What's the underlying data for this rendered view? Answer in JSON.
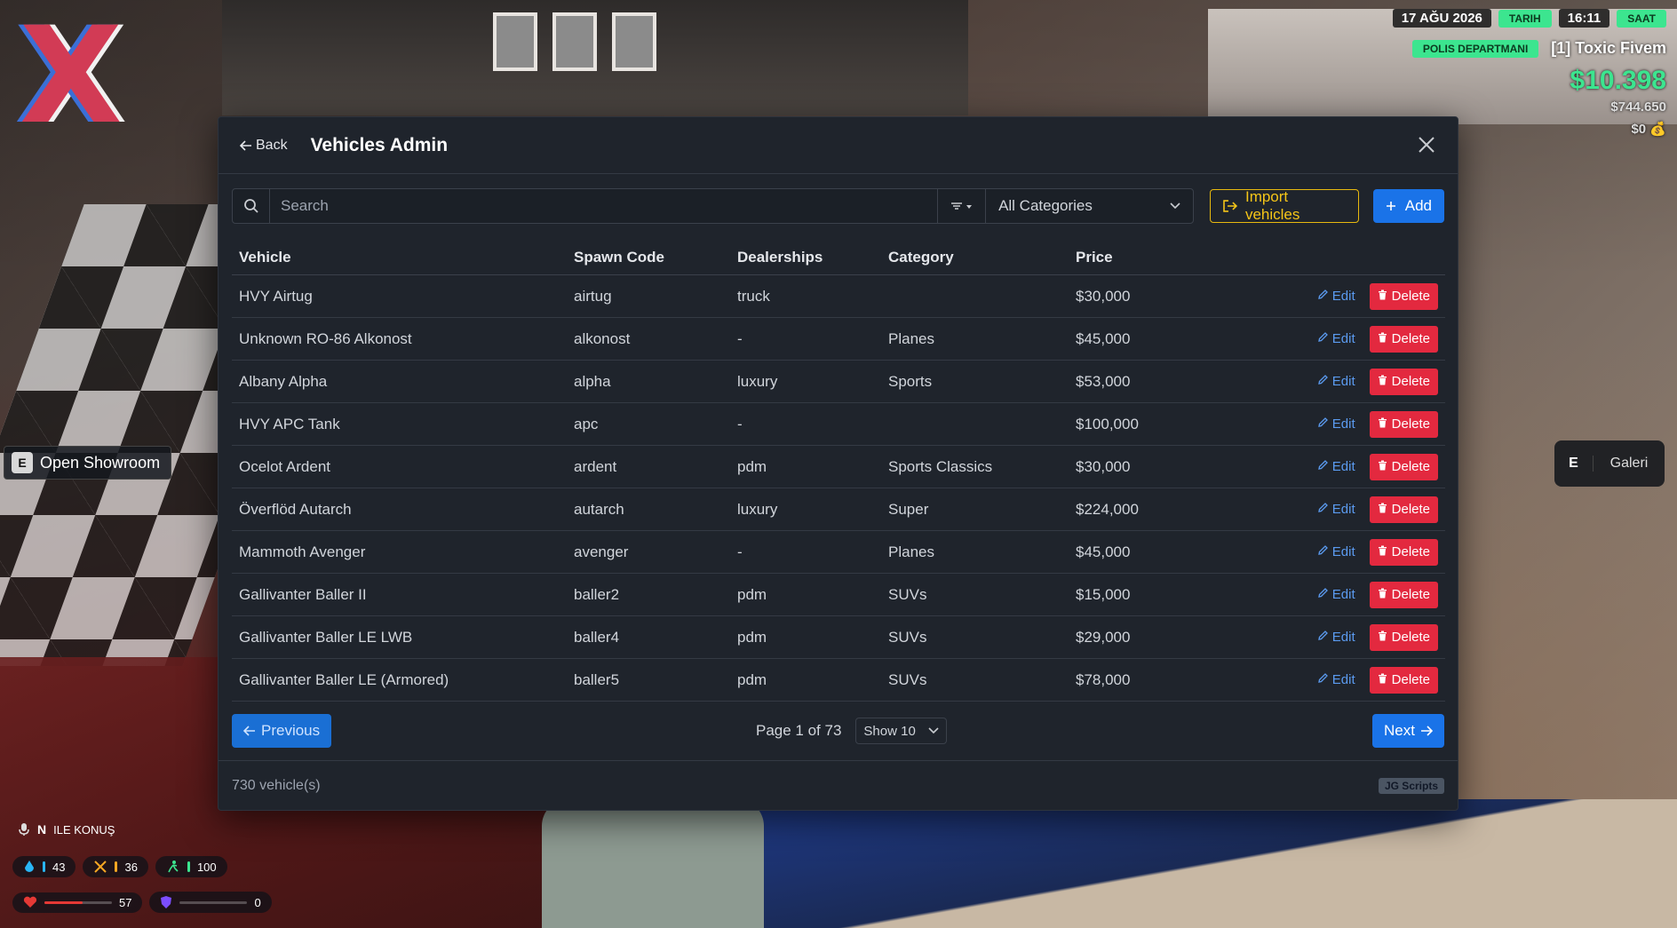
{
  "hud": {
    "date": "17 AĞU 2026",
    "date_label": "TARIH",
    "time": "16:11",
    "time_label": "SAAT",
    "job": "POLIS DEPARTMANI",
    "player": "[1] Toxic Fivem",
    "cash": "$10.398",
    "bank": "$744.650",
    "black_money": "$0",
    "voice_key": "N",
    "voice_label": "ILE KONUŞ",
    "stats": {
      "water": "43",
      "food": "36",
      "stamina": "100",
      "health": "57",
      "health_level": 0.57,
      "armor": "0"
    },
    "showroom_key": "E",
    "showroom_label": "Open Showroom",
    "galeri_key": "E",
    "galeri_label": "Galeri"
  },
  "modal": {
    "back_label": "Back",
    "title": "Vehicles Admin",
    "search_placeholder": "Search",
    "category_value": "All Categories",
    "import_label": "Import vehicles",
    "add_label": "Add",
    "columns": {
      "vehicle": "Vehicle",
      "spawn": "Spawn Code",
      "dealerships": "Dealerships",
      "category": "Category",
      "price": "Price"
    },
    "edit_label": "Edit",
    "delete_label": "Delete",
    "rows": [
      {
        "vehicle": "HVY Airtug",
        "spawn": "airtug",
        "dealership": "truck",
        "category": "",
        "price": "$30,000"
      },
      {
        "vehicle": "Unknown RO-86 Alkonost",
        "spawn": "alkonost",
        "dealership": "-",
        "category": "Planes",
        "price": "$45,000"
      },
      {
        "vehicle": "Albany Alpha",
        "spawn": "alpha",
        "dealership": "luxury",
        "category": "Sports",
        "price": "$53,000"
      },
      {
        "vehicle": "HVY APC Tank",
        "spawn": "apc",
        "dealership": "-",
        "category": "",
        "price": "$100,000"
      },
      {
        "vehicle": "Ocelot Ardent",
        "spawn": "ardent",
        "dealership": "pdm",
        "category": "Sports Classics",
        "price": "$30,000"
      },
      {
        "vehicle": "Överflöd Autarch",
        "spawn": "autarch",
        "dealership": "luxury",
        "category": "Super",
        "price": "$224,000"
      },
      {
        "vehicle": "Mammoth Avenger",
        "spawn": "avenger",
        "dealership": "-",
        "category": "Planes",
        "price": "$45,000"
      },
      {
        "vehicle": "Gallivanter Baller II",
        "spawn": "baller2",
        "dealership": "pdm",
        "category": "SUVs",
        "price": "$15,000"
      },
      {
        "vehicle": "Gallivanter Baller LE LWB",
        "spawn": "baller4",
        "dealership": "pdm",
        "category": "SUVs",
        "price": "$29,000"
      },
      {
        "vehicle": "Gallivanter Baller LE (Armored)",
        "spawn": "baller5",
        "dealership": "pdm",
        "category": "SUVs",
        "price": "$78,000"
      }
    ],
    "prev_label": "Previous",
    "next_label": "Next",
    "page_text": "Page 1 of 73",
    "page_size": "Show 10",
    "count_text": "730 vehicle(s)",
    "brand": "JG Scripts"
  },
  "colors": {
    "accent_blue": "#1a73e8",
    "danger_red": "#e3293f",
    "import_yellow": "#f5c518",
    "hud_green": "#3ce58f"
  }
}
